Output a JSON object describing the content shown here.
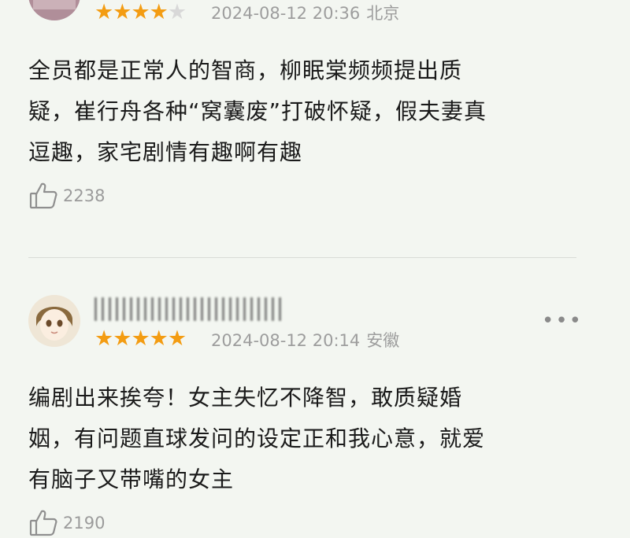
{
  "comments": [
    {
      "rating": 4,
      "max_rating": 5,
      "date": "2024-08-12 20:36",
      "location": "北京",
      "lines": [
        "全员都是正常人的智商，柳眠棠频频提出质",
        "疑，崔行舟各种“窝囊废”打破怀疑，假夫妻真",
        "逗趣，家宅剧情有趣啊有趣"
      ],
      "likes": "2238"
    },
    {
      "rating": 5,
      "max_rating": 5,
      "date": "2024-08-12 20:14",
      "location": "安徽",
      "lines": [
        "编剧出来挨夸！女主失忆不降智，敢质疑婚",
        "姻，有问题直球发问的设定正和我心意，就爱",
        "有脑子又带嘴的女主"
      ],
      "likes": "2190"
    }
  ],
  "more_icon": "more-dots-icon",
  "like_icon": "thumbs-up-icon",
  "colors": {
    "star": "#f39c12",
    "meta": "#9d9d9d",
    "background": "#f3f6f1"
  }
}
